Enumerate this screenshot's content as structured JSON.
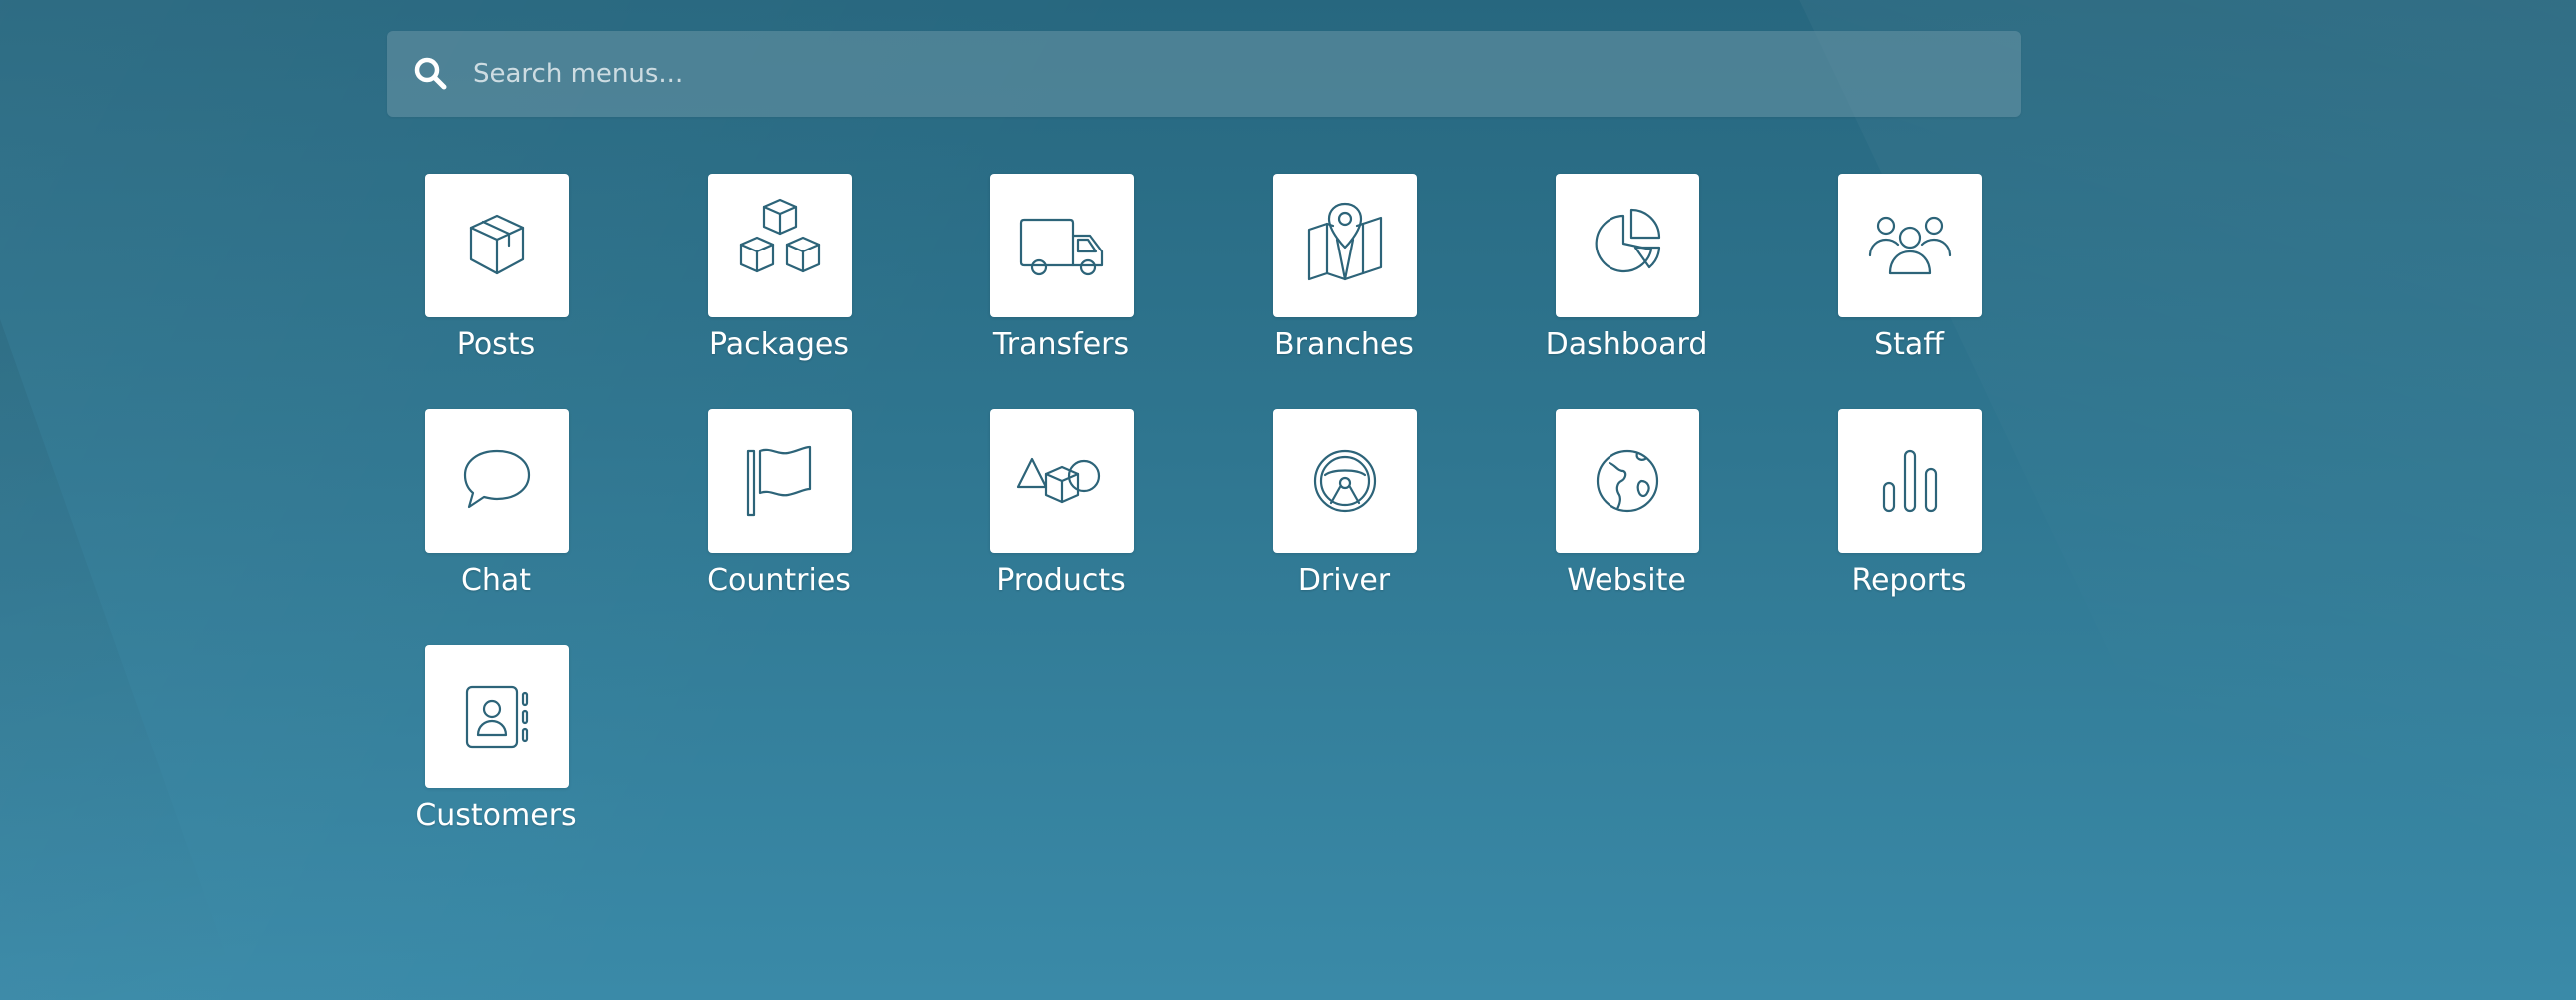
{
  "search": {
    "placeholder": "Search menus...",
    "value": "",
    "icon": "search-icon"
  },
  "menus": [
    {
      "label": "Posts",
      "icon": "box-icon"
    },
    {
      "label": "Packages",
      "icon": "stacked-boxes-icon"
    },
    {
      "label": "Transfers",
      "icon": "truck-icon"
    },
    {
      "label": "Branches",
      "icon": "map-pin-icon"
    },
    {
      "label": "Dashboard",
      "icon": "pie-chart-icon"
    },
    {
      "label": "Staff",
      "icon": "people-icon"
    },
    {
      "label": "Chat",
      "icon": "speech-bubble-icon"
    },
    {
      "label": "Countries",
      "icon": "flag-icon"
    },
    {
      "label": "Products",
      "icon": "shapes-icon"
    },
    {
      "label": "Driver",
      "icon": "steering-wheel-icon"
    },
    {
      "label": "Website",
      "icon": "globe-icon"
    },
    {
      "label": "Reports",
      "icon": "bar-chart-icon"
    },
    {
      "label": "Customers",
      "icon": "contact-book-icon"
    }
  ],
  "colors": {
    "icon_stroke": "#2d6479",
    "tile_bg": "#ffffff",
    "label_text": "#ffffff",
    "background_top": "#27677f",
    "background_bottom": "#3a8aa8"
  }
}
